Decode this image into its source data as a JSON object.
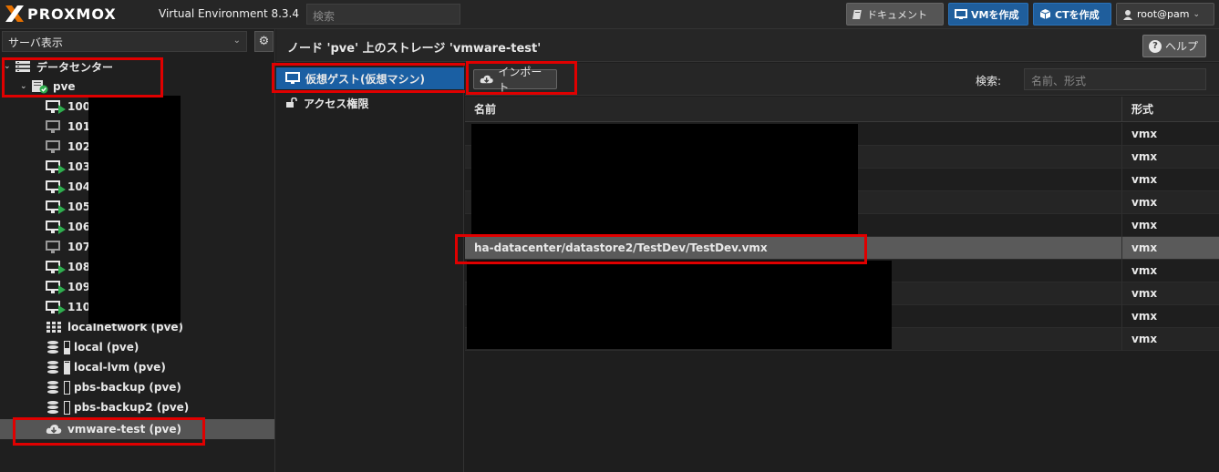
{
  "topbar": {
    "logo_text": "PROXMOX",
    "version": "Virtual Environment 8.3.4",
    "search_placeholder": "検索",
    "docs_label": "ドキュメント",
    "create_vm_label": "VMを作成",
    "create_ct_label": "CTを作成",
    "user_label": "root@pam"
  },
  "sidebar": {
    "view_select": "サーバ表示",
    "tree": [
      {
        "label": "データセンター",
        "type": "datacenter"
      },
      {
        "label": "pve",
        "type": "node"
      },
      {
        "label": "100",
        "type": "vm",
        "running": true
      },
      {
        "label": "101",
        "type": "vm",
        "running": false
      },
      {
        "label": "102",
        "type": "vm",
        "running": false
      },
      {
        "label": "103",
        "type": "vm",
        "running": true
      },
      {
        "label": "104",
        "type": "vm",
        "running": true
      },
      {
        "label": "105",
        "type": "vm",
        "running": true
      },
      {
        "label": "106",
        "type": "vm",
        "running": true
      },
      {
        "label": "107",
        "type": "vm",
        "running": false
      },
      {
        "label": "108",
        "type": "vm",
        "running": true
      },
      {
        "label": "109",
        "type": "vm",
        "running": true
      },
      {
        "label": "110",
        "type": "vm",
        "running": true
      },
      {
        "label": "localnetwork (pve)",
        "type": "sdn"
      },
      {
        "label": "local (pve)",
        "type": "storage"
      },
      {
        "label": "local-lvm (pve)",
        "type": "storage"
      },
      {
        "label": "pbs-backup (pve)",
        "type": "storage"
      },
      {
        "label": "pbs-backup2 (pve)",
        "type": "storage"
      },
      {
        "label": "vmware-test (pve)",
        "type": "esxi",
        "selected": true
      }
    ]
  },
  "main": {
    "title": "ノード 'pve' 上のストレージ 'vmware-test'",
    "help_label": "ヘルプ",
    "submenu": [
      {
        "label": "仮想ゲスト(仮想マシン)",
        "active": true
      },
      {
        "label": "アクセス権限",
        "active": false
      }
    ],
    "toolbar": {
      "import_label": "インポート",
      "search_label": "検索:",
      "search_placeholder": "名前、形式"
    },
    "grid": {
      "columns": [
        "名前",
        "形式"
      ],
      "rows": [
        {
          "name": "",
          "format": "vmx"
        },
        {
          "name": "",
          "format": "vmx"
        },
        {
          "name": "",
          "format": "vmx"
        },
        {
          "name": "",
          "format": "vmx"
        },
        {
          "name": "",
          "format": "vmx"
        },
        {
          "name": "ha-datacenter/datastore2/TestDev/TestDev.vmx",
          "format": "vmx",
          "selected": true
        },
        {
          "name": "",
          "format": "vmx"
        },
        {
          "name": "",
          "format": "vmx"
        },
        {
          "name": "",
          "format": "vmx"
        },
        {
          "name": "",
          "format": "vmx"
        }
      ]
    }
  },
  "colors": {
    "accent": "#1a5fa3",
    "running": "#2fae4f",
    "highlight": "#e00000"
  }
}
